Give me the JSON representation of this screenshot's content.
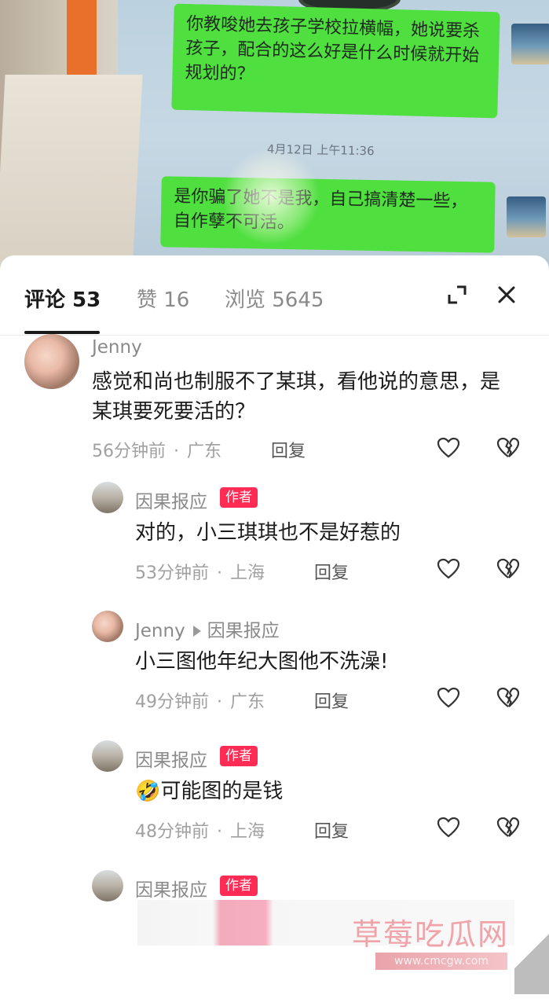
{
  "photo": {
    "bubble1_text": "你教唆她去孩子学校拉横幅，她说要杀孩子，配合的这么好是什么时候就开始规划的？",
    "chat_time": "4月12日 上午11:36",
    "bubble2_text": "是你骗了她不是我，自己搞清楚一些，自作孽不可活。"
  },
  "tabs": {
    "comments": "评论 53",
    "likes": "赞 16",
    "views": "浏览 5645"
  },
  "comments": [
    {
      "name": "Jenny",
      "text": "感觉和尚也制服不了某琪，看他说的意思，是某琪要死要活的？",
      "time": "56分钟前",
      "location": "广东",
      "reply": "回复"
    },
    {
      "name": "因果报应",
      "badge": "作者",
      "text": "对的，小三琪琪也不是好惹的",
      "time": "53分钟前",
      "location": "上海",
      "reply": "回复"
    },
    {
      "name": "Jenny",
      "reply_to": "因果报应",
      "text": "小三图他年纪大图他不洗澡!",
      "time": "49分钟前",
      "location": "广东",
      "reply": "回复"
    },
    {
      "name": "因果报应",
      "badge": "作者",
      "emoji": "🤣",
      "text": "可能图的是钱",
      "time": "48分钟前",
      "location": "上海",
      "reply": "回复"
    },
    {
      "name": "因果报应",
      "badge": "作者"
    }
  ],
  "watermark": {
    "text": "草莓吃瓜网",
    "url": "www.cmcgw.com"
  },
  "colors": {
    "accent": "#fe2c55",
    "bubble": "#4fdf3f"
  },
  "icons": [
    "expand-icon",
    "close-icon",
    "heart-icon",
    "broken-heart-icon",
    "arrow-right-icon"
  ]
}
